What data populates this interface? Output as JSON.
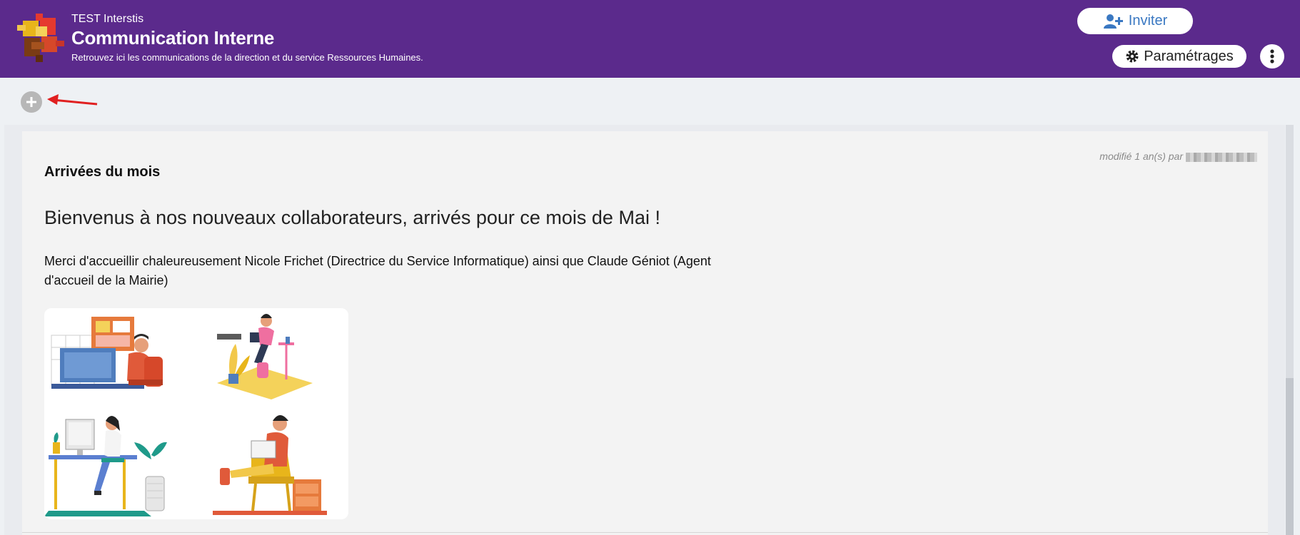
{
  "header": {
    "org_name": "TEST Interstis",
    "title": "Communication Interne",
    "subtitle": "Retrouvez ici les communications de la direction et du service Ressources Humaines.",
    "invite_label": "Inviter",
    "settings_label": "Paramétrages",
    "icons": [
      "puzzle-logo",
      "user-plus-icon",
      "gear-icon",
      "more-vertical-icon"
    ]
  },
  "toolbar": {
    "icons": [
      "plus-icon",
      "red-arrow-annotation"
    ]
  },
  "post": {
    "modified_label": "modifié 1 an(s) par",
    "title": "Arrivées du mois",
    "headline": "Bienvenus à nos nouveaux collaborateurs, arrivés pour ce mois de Mai !",
    "body": "Merci d'accueillir chaleureusement Nicole Frichet (Directrice du Service Informatique) ainsi que Claude Géniot (Agent d'accueil de la Mairie)"
  },
  "colors": {
    "header_bg": "#5b2a8c",
    "invite_text": "#3a78c2",
    "arrow": "#e02020",
    "card_bg": "#f3f3f3",
    "page_bg": "#eef1f4"
  }
}
